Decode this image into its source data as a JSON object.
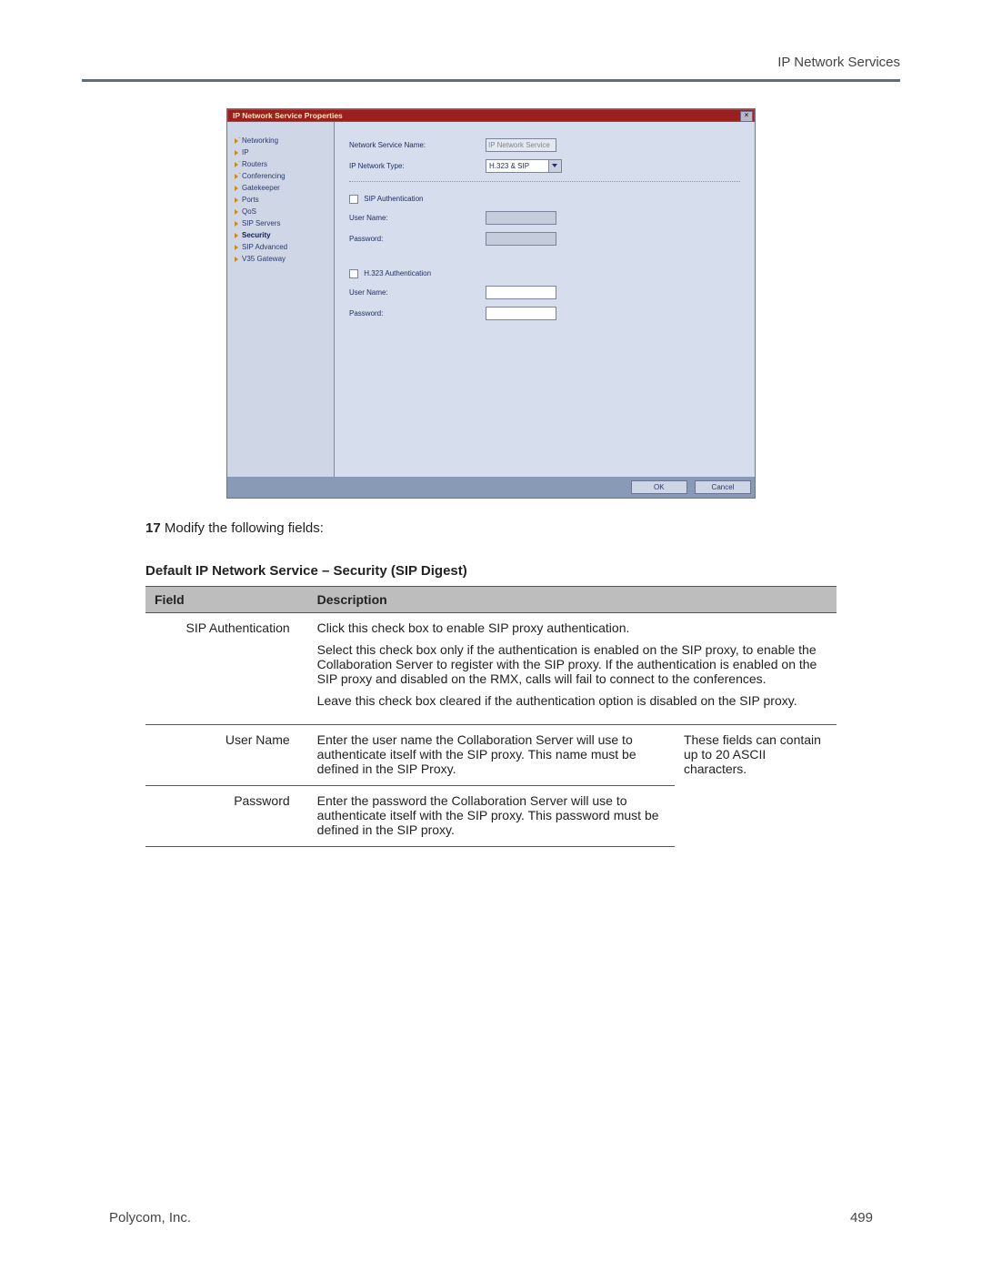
{
  "header": {
    "section_title": "IP Network Services"
  },
  "dialog": {
    "title": "IP Network Service Properties",
    "sidebar": {
      "items": [
        {
          "label": "Networking",
          "style": "arrowdots"
        },
        {
          "label": "IP",
          "style": "arrow"
        },
        {
          "label": "Routers",
          "style": "arrowdots"
        },
        {
          "label": "Conferencing",
          "style": "arrowdots"
        },
        {
          "label": "Gatekeeper",
          "style": "arrow"
        },
        {
          "label": "Ports",
          "style": "arrow"
        },
        {
          "label": "QoS",
          "style": "arrow"
        },
        {
          "label": "SIP Servers",
          "style": "arrow"
        },
        {
          "label": "Security",
          "style": "arrow",
          "selected": true
        },
        {
          "label": "SIP Advanced",
          "style": "arrow"
        },
        {
          "label": "V35 Gateway",
          "style": "arrow"
        }
      ]
    },
    "form": {
      "service_name_label": "Network Service Name:",
      "service_name_value": "IP Network Service",
      "network_type_label": "IP Network Type:",
      "network_type_value": "H.323 & SIP",
      "sip_auth_label": "SIP Authentication",
      "sip_user_label": "User Name:",
      "sip_pass_label": "Password:",
      "h323_auth_label": "H.323 Authentication",
      "h323_user_label": "User Name:",
      "h323_pass_label": "Password:"
    },
    "buttons": {
      "ok": "OK",
      "cancel": "Cancel"
    }
  },
  "step": {
    "number": "17",
    "text": "Modify the following fields:"
  },
  "table": {
    "caption": "Default IP Network Service – Security (SIP Digest)",
    "header_field": "Field",
    "header_desc": "Description",
    "rows": {
      "r0": {
        "field": "SIP Authentication",
        "p1": "Click this check box to enable SIP proxy authentication.",
        "p2": "Select this check box only if the authentication is enabled on the SIP proxy, to enable the Collaboration Server to register with the SIP proxy. If the authentication is enabled on the SIP proxy and disabled on the RMX, calls will fail to connect to the conferences.",
        "p3": "Leave this check box cleared if the authentication option is disabled on the SIP proxy."
      },
      "r1": {
        "field": "User Name",
        "desc": "Enter the user name the Collaboration Server will use to authenticate itself with the SIP proxy. This name must be defined in the SIP Proxy."
      },
      "r2": {
        "field": "Password",
        "desc": "Enter the password the Collaboration Server will use to authenticate itself with the SIP proxy. This password must be defined in the SIP proxy."
      },
      "note": "These fields can contain up to 20 ASCII characters."
    }
  },
  "footer": {
    "company": "Polycom, Inc.",
    "page": "499"
  }
}
